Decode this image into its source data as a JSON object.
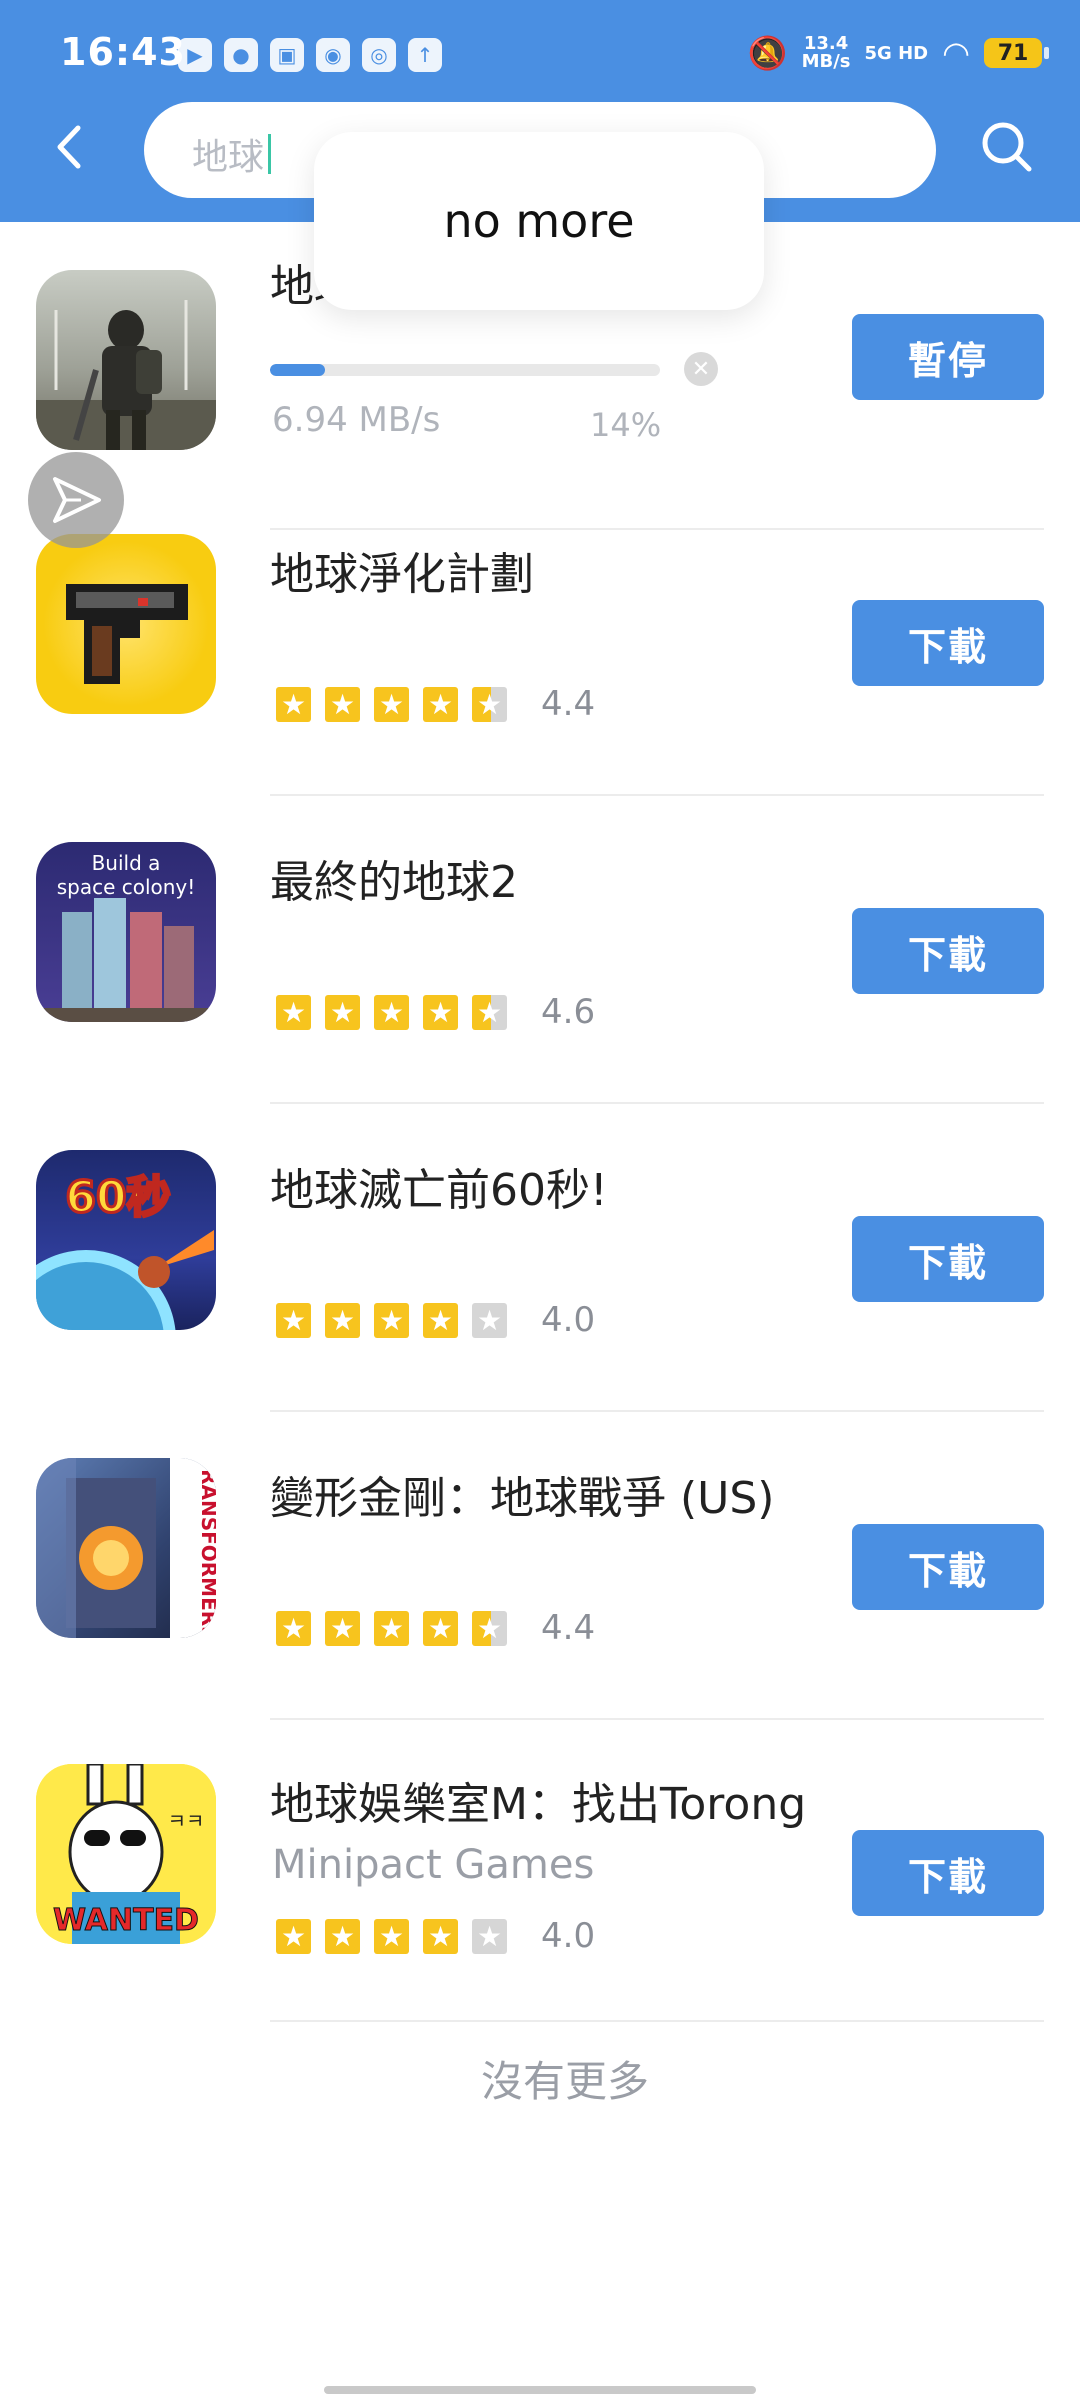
{
  "status_bar": {
    "time": "16:43",
    "net_speed_value": "13.4",
    "net_speed_unit": "MB/s",
    "signal": "5G HD",
    "battery": "71"
  },
  "header": {
    "search_query": "地球"
  },
  "toast": {
    "text": "no more"
  },
  "items": [
    {
      "name": "地球末日：生存",
      "button": "暫停",
      "download_speed": "6.94 MB/s",
      "download_percent": "14%",
      "progress": 0.14
    },
    {
      "name": "地球淨化計劃",
      "rating": "4.4",
      "stars": [
        "full",
        "full",
        "full",
        "full",
        "half"
      ],
      "button": "下載"
    },
    {
      "name": "最終的地球2",
      "icon_text_1": "Build a",
      "icon_text_2": "space colony!",
      "rating": "4.6",
      "stars": [
        "full",
        "full",
        "full",
        "full",
        "half"
      ],
      "button": "下載"
    },
    {
      "name": "地球滅亡前60秒!",
      "icon_text": "60秒",
      "rating": "4.0",
      "stars": [
        "full",
        "full",
        "full",
        "full",
        "empty"
      ],
      "button": "下載"
    },
    {
      "name": "變形金剛：地球戰爭 (US)",
      "icon_text": "TRANSFORMERS",
      "rating": "4.4",
      "stars": [
        "full",
        "full",
        "full",
        "full",
        "half"
      ],
      "button": "下載"
    },
    {
      "name": "地球娛樂室M：找出Torong",
      "developer": "Minipact Games",
      "icon_text": "WANTED",
      "icon_text_2": "ㅋㅋ",
      "rating": "4.0",
      "stars": [
        "full",
        "full",
        "full",
        "full",
        "empty"
      ],
      "button": "下載"
    }
  ],
  "footer": {
    "no_more_text": "沒有更多"
  },
  "colors": {
    "brand": "#4a8fe2",
    "star": "#f7c41e",
    "star_empty": "#d6d6d6"
  }
}
